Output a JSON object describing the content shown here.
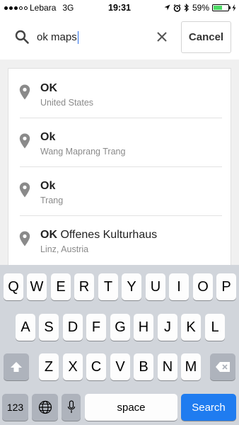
{
  "status_bar": {
    "carrier": "Lebara",
    "network": "3G",
    "time": "19:31",
    "battery": "59%",
    "battery_level": 0.59,
    "signal_bars_filled": 3,
    "signal_bars_total": 5
  },
  "search": {
    "query": "ok maps",
    "cancel_label": "Cancel"
  },
  "results": [
    {
      "title_bold": "OK",
      "title_rest": "",
      "subtitle": "United States"
    },
    {
      "title_bold": "Ok",
      "title_rest": "",
      "subtitle": "Wang Maprang Trang"
    },
    {
      "title_bold": "Ok",
      "title_rest": "",
      "subtitle": "Trang"
    },
    {
      "title_bold": "OK",
      "title_rest": " Offenes Kulturhaus",
      "subtitle": "Linz, Austria"
    }
  ],
  "keyboard": {
    "row1": [
      "Q",
      "W",
      "E",
      "R",
      "T",
      "Y",
      "U",
      "I",
      "O",
      "P"
    ],
    "row2": [
      "A",
      "S",
      "D",
      "F",
      "G",
      "H",
      "J",
      "K",
      "L"
    ],
    "row3": [
      "Z",
      "X",
      "C",
      "V",
      "B",
      "N",
      "M"
    ],
    "numbers_label": "123",
    "space_label": "space",
    "search_label": "Search"
  },
  "colors": {
    "accent": "#1f7cf0",
    "battery_fill": "#4cd964",
    "keyboard_bg": "#d1d5db",
    "pin": "#8a8a8a"
  },
  "icons": [
    "search-icon",
    "clear-icon",
    "location-pin-icon",
    "shift-icon",
    "backspace-icon",
    "globe-icon",
    "microphone-icon",
    "location-arrow-icon",
    "alarm-icon",
    "bluetooth-icon",
    "battery-icon"
  ]
}
